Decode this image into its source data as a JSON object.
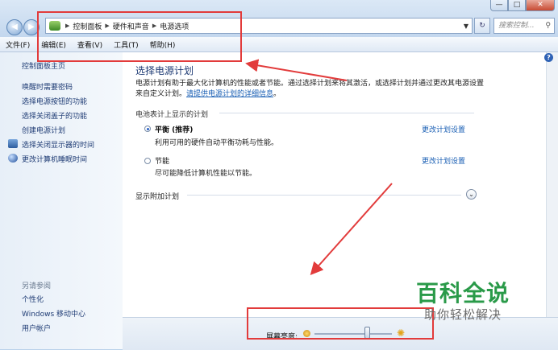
{
  "window": {
    "controls": {
      "minimize": "—",
      "maximize": "□",
      "close": "✕"
    }
  },
  "nav": {
    "back": "◀",
    "forward": "▶"
  },
  "address": {
    "crumbs": [
      "控制面板",
      "硬件和声音",
      "电源选项"
    ]
  },
  "search": {
    "placeholder": "搜索控制..."
  },
  "menu": [
    "文件(F)",
    "编辑(E)",
    "查看(V)",
    "工具(T)",
    "帮助(H)"
  ],
  "sidebar": {
    "home": "控制面板主页",
    "items": [
      "唤醒时需要密码",
      "选择电源按钮的功能",
      "选择关闭盖子的功能",
      "创建电源计划",
      "选择关闭显示器的时间",
      "更改计算机睡眠时间"
    ],
    "see_also": "另请参阅",
    "see_also_items": [
      "个性化",
      "Windows 移动中心",
      "用户帐户"
    ]
  },
  "main": {
    "title": "选择电源计划",
    "desc_before": "电源计划有助于最大化计算机的性能或者节能。通过选择计划来将其激活，或选择计划并通过更改其电源设置来自定义计划。",
    "desc_link": "请提供电源计划的详细信息",
    "desc_after": "。",
    "group_label": "电池表计上显示的计划",
    "plans": [
      {
        "name": "平衡 (推荐)",
        "desc": "利用可用的硬件自动平衡功耗与性能。",
        "link": "更改计划设置",
        "selected": true
      },
      {
        "name": "节能",
        "desc": "尽可能降低计算机性能以节能。",
        "link": "更改计划设置",
        "selected": false
      }
    ],
    "more_plans": "显示附加计划"
  },
  "bottom": {
    "brightness_label": "屏幕亮度:",
    "brightness_level_percent": 68
  },
  "watermark": {
    "title": "百科全说",
    "subtitle": "助你轻松解决"
  },
  "colors": {
    "annotation": "#e23b3b",
    "link": "#1a5fb4",
    "watermark": "#2a9a49"
  }
}
